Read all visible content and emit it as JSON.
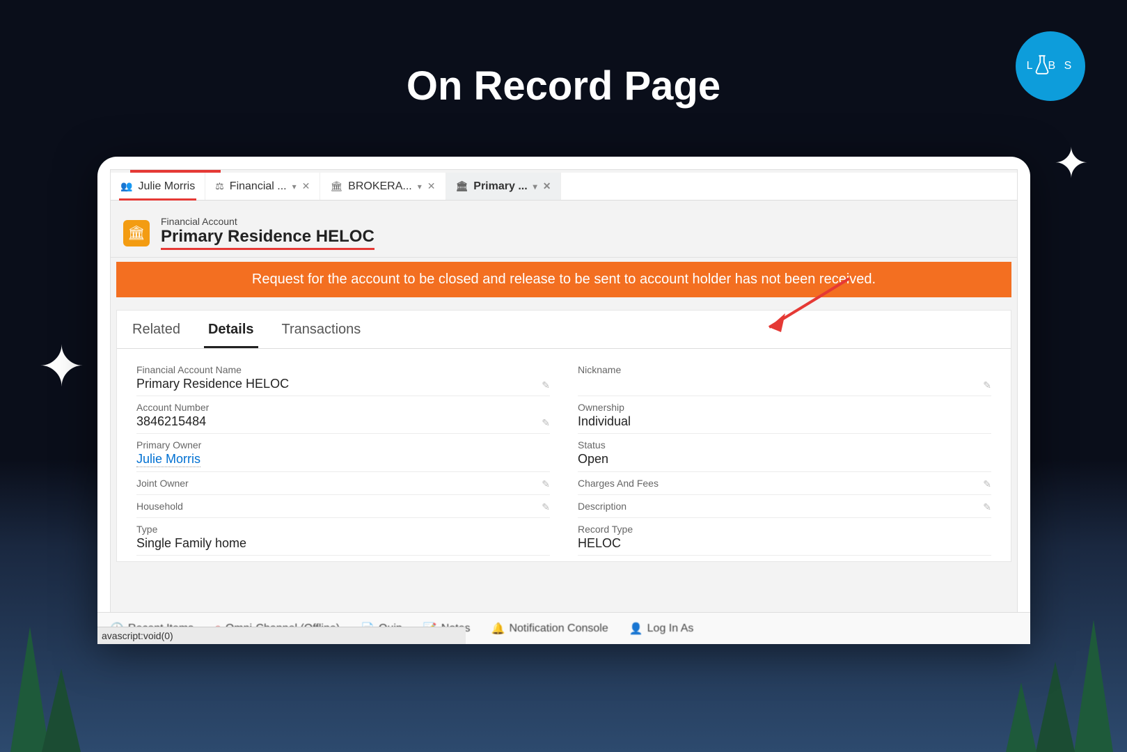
{
  "slide": {
    "title": "On Record Page"
  },
  "labs_badge": {
    "text_l": "L",
    "text_bs": "B S"
  },
  "tabs": [
    {
      "icon": "people",
      "label": "Julie Morris",
      "closable": false,
      "dropdown": false,
      "underline": true
    },
    {
      "icon": "accounts",
      "label": "Financial ...",
      "closable": true,
      "dropdown": true
    },
    {
      "icon": "bank",
      "label": "BROKERA...",
      "closable": true,
      "dropdown": true
    },
    {
      "icon": "bank",
      "label": "Primary ...",
      "closable": true,
      "dropdown": true,
      "active": true
    }
  ],
  "record_header": {
    "object_label": "Financial Account",
    "title": "Primary Residence HELOC"
  },
  "banner": {
    "text": "Request for the account to be closed and release to be sent to account holder has not been received."
  },
  "content_tabs": [
    {
      "label": "Related"
    },
    {
      "label": "Details",
      "active": true
    },
    {
      "label": "Transactions"
    }
  ],
  "fields_left": [
    {
      "label": "Financial Account Name",
      "value": "Primary Residence HELOC",
      "editable": true
    },
    {
      "label": "Account Number",
      "value": "3846215484",
      "editable": true
    },
    {
      "label": "Primary Owner",
      "value": "Julie Morris",
      "link": true,
      "editable": false
    },
    {
      "label": "Joint Owner",
      "value": "",
      "editable": true
    },
    {
      "label": "Household",
      "value": "",
      "editable": true
    },
    {
      "label": "Type",
      "value": "Single Family home",
      "editable": false
    }
  ],
  "fields_right": [
    {
      "label": "Nickname",
      "value": "",
      "editable": true
    },
    {
      "label": "Ownership",
      "value": "Individual",
      "editable": false
    },
    {
      "label": "Status",
      "value": "Open",
      "editable": false
    },
    {
      "label": "Charges And Fees",
      "value": "",
      "editable": true
    },
    {
      "label": "Description",
      "value": "",
      "editable": true
    },
    {
      "label": "Record Type",
      "value": "HELOC",
      "editable": false
    }
  ],
  "utility_bar": [
    {
      "icon": "clock",
      "label": "Recent Items"
    },
    {
      "icon": "omni",
      "label": "Omni-Channel (Offline)"
    },
    {
      "icon": "quip",
      "label": "Quip"
    },
    {
      "icon": "notes",
      "label": "Notes"
    },
    {
      "icon": "bell",
      "label": "Notification Console"
    },
    {
      "icon": "person",
      "label": "Log In As"
    }
  ],
  "status_bar": {
    "text": "avascript:void(0)"
  }
}
